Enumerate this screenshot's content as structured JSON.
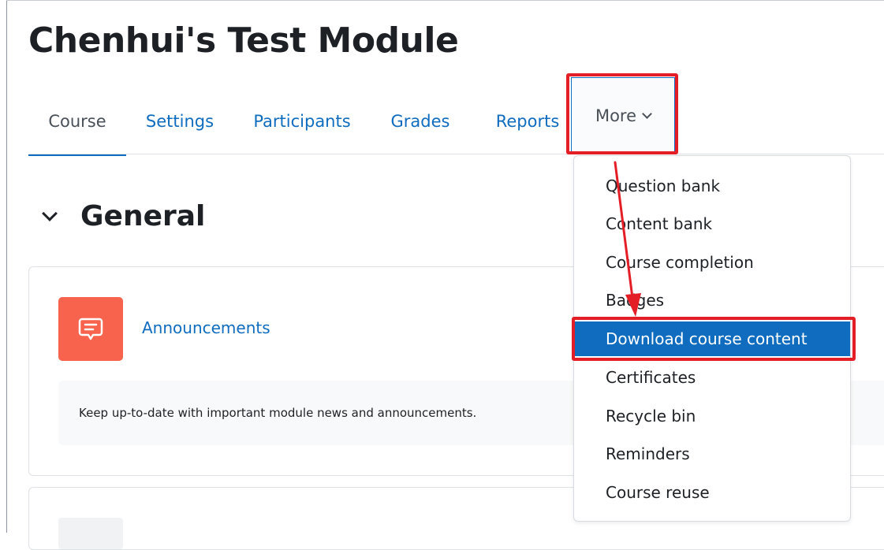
{
  "page": {
    "title": "Chenhui's Test Module"
  },
  "nav": {
    "tabs": [
      {
        "label": "Course",
        "active": true
      },
      {
        "label": "Settings"
      },
      {
        "label": "Participants"
      },
      {
        "label": "Grades"
      },
      {
        "label": "Reports"
      }
    ],
    "more_label": "More"
  },
  "more_menu": {
    "items": [
      {
        "label": "Question bank"
      },
      {
        "label": "Content bank"
      },
      {
        "label": "Course completion"
      },
      {
        "label": "Badges"
      },
      {
        "label": "Download course content",
        "highlighted": true
      },
      {
        "label": "Certificates"
      },
      {
        "label": "Recycle bin"
      },
      {
        "label": "Reminders"
      },
      {
        "label": "Course reuse"
      }
    ]
  },
  "section": {
    "title": "General",
    "collapse_icon": "chevron-down-icon"
  },
  "activity": {
    "icon": "forum-icon",
    "name": "Announcements",
    "description": "Keep up-to-date with important module news and announcements."
  },
  "colors": {
    "link": "#0f6cbf",
    "forum_icon_bg": "#f7634d",
    "highlight_frame": "#e41e26",
    "menu_active_bg": "#0f6cbf"
  }
}
